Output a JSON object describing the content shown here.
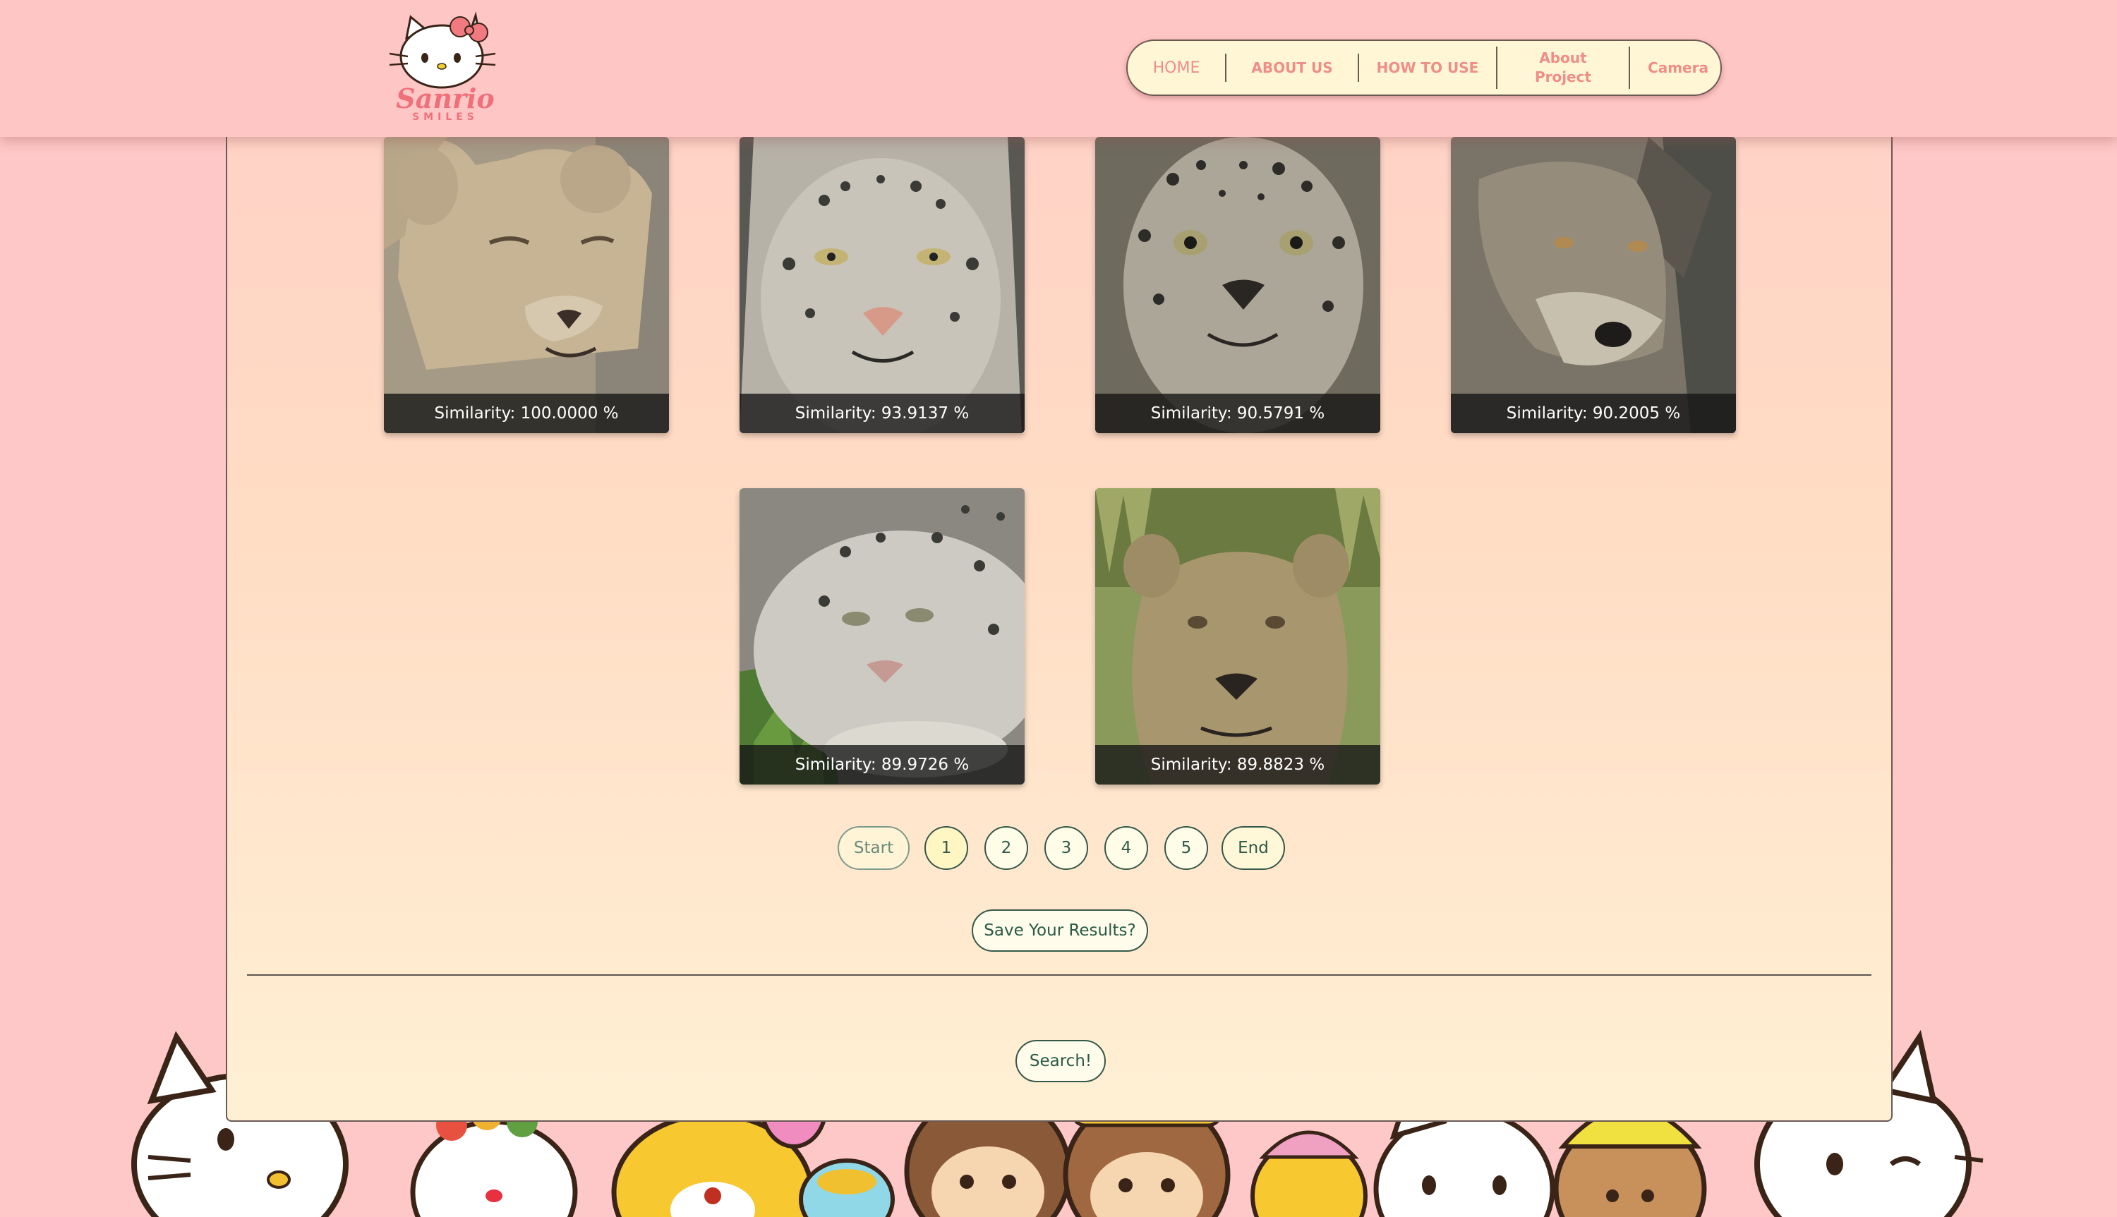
{
  "logo": {
    "name": "Sanrio",
    "tagline": "SMILES"
  },
  "nav": {
    "home": "HOME",
    "about_us": "ABOUT US",
    "how_to_use": "HOW TO USE",
    "about_project": "About Project",
    "camera": "Camera"
  },
  "results": [
    {
      "caption": "Similarity: 100.0000 %",
      "animal": "lion cub"
    },
    {
      "caption": "Similarity: 93.9137 %",
      "animal": "snow leopard"
    },
    {
      "caption": "Similarity: 90.5791 %",
      "animal": "snow leopard"
    },
    {
      "caption": "Similarity: 90.2005 %",
      "animal": "wolf"
    },
    {
      "caption": "Similarity: 89.9726 %",
      "animal": "snow leopard"
    },
    {
      "caption": "Similarity: 89.8823 %",
      "animal": "lioness"
    }
  ],
  "pagination": {
    "start": "Start",
    "pages": [
      "1",
      "2",
      "3",
      "4",
      "5"
    ],
    "end": "End",
    "current_page": "1"
  },
  "actions": {
    "save": "Save Your Results?",
    "search": "Search!"
  },
  "colors": {
    "page_bg": "#ffc8c8",
    "nav_text": "#ef8e86",
    "button_text": "#2f5a48",
    "card_bg": "#ffe6cc"
  }
}
